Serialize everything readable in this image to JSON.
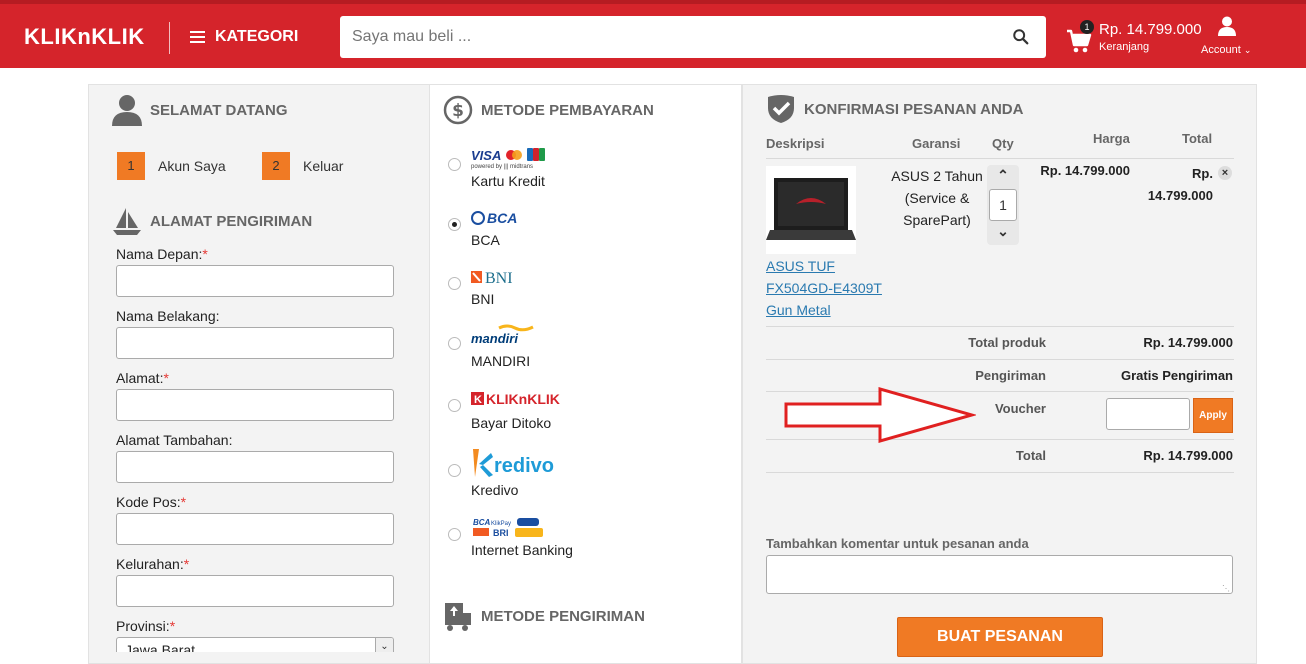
{
  "header": {
    "logo": "KLIKnKLIK",
    "category_label": "KATEGORI",
    "search_placeholder": "Saya mau beli ...",
    "cart_count": "1",
    "cart_total": "Rp. 14.799.000",
    "cart_label": "Keranjang",
    "account_label": "Account"
  },
  "welcome": {
    "title": "SELAMAT DATANG",
    "steps": [
      {
        "number": "1",
        "label": "Akun Saya"
      },
      {
        "number": "2",
        "label": "Keluar"
      }
    ]
  },
  "shipping_address": {
    "title": "ALAMAT PENGIRIMAN",
    "fields": [
      {
        "label": "Nama Depan:",
        "required": "*"
      },
      {
        "label": "Nama Belakang:",
        "required": ""
      },
      {
        "label": "Alamat:",
        "required": "*"
      },
      {
        "label": "Alamat Tambahan:",
        "required": ""
      },
      {
        "label": "Kode Pos:",
        "required": "*"
      },
      {
        "label": "Kelurahan:",
        "required": "*"
      },
      {
        "label": "Provinsi:",
        "required": "*"
      }
    ],
    "province_value": "Jawa Barat"
  },
  "payment": {
    "title": "METODE PEMBAYARAN",
    "methods": [
      {
        "label": "Kartu Kredit",
        "logo": "VISA powered by midtrans"
      },
      {
        "label": "BCA",
        "logo": "BCA"
      },
      {
        "label": "BNI",
        "logo": "BNI"
      },
      {
        "label": "MANDIRI",
        "logo": "mandiri"
      },
      {
        "label": "Bayar Ditoko",
        "logo": "KLIKnKLIK"
      },
      {
        "label": "Kredivo",
        "logo": "kredivo"
      },
      {
        "label": "Internet Banking",
        "logo": "BCA KlikPay BRI"
      }
    ],
    "selected": "BCA",
    "shipping_method_title": "METODE PENGIRIMAN"
  },
  "order": {
    "title": "KONFIRMASI PESANAN ANDA",
    "columns": [
      "Deskripsi",
      "Garansi",
      "Qty",
      "Harga",
      "Total"
    ],
    "item": {
      "name_lines": [
        "ASUS TUF",
        "FX504GD-E4309T",
        "Gun Metal"
      ],
      "warranty_lines": [
        "ASUS 2 Tahun",
        "(Service &",
        "SparePart)"
      ],
      "qty": "1",
      "price": "Rp. 14.799.000",
      "total_lines": [
        "Rp.",
        "14.799.000"
      ]
    },
    "total_produk_label": "Total produk",
    "total_produk_value": "Rp. 14.799.000",
    "pengiriman_label": "Pengiriman",
    "pengiriman_value": "Gratis Pengiriman",
    "voucher_label": "Voucher",
    "apply_label": "Apply",
    "total_label": "Total",
    "total_value": "Rp. 14.799.000",
    "comment_label": "Tambahkan komentar untuk pesanan anda",
    "submit_label": "BUAT PESANAN"
  },
  "colors": {
    "brand_red": "#d5242b",
    "accent_orange": "#f07a24",
    "arrow_red": "#e02020"
  }
}
